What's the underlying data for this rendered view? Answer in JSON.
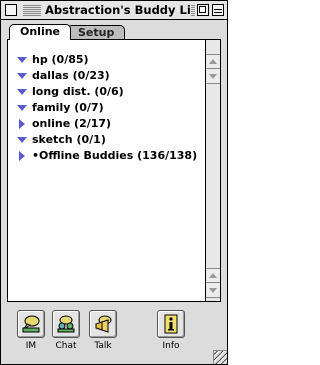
{
  "window": {
    "title": "Abstraction's Buddy List"
  },
  "tabs": [
    {
      "label": "Online",
      "active": true
    },
    {
      "label": "Setup",
      "active": false
    }
  ],
  "groups": [
    {
      "label": "hp (0/85)",
      "expanded": true
    },
    {
      "label": "dallas (0/23)",
      "expanded": true
    },
    {
      "label": "long dist. (0/6)",
      "expanded": true
    },
    {
      "label": "family (0/7)",
      "expanded": true
    },
    {
      "label": "online (2/17)",
      "expanded": false
    },
    {
      "label": "sketch (0/1)",
      "expanded": true
    },
    {
      "label": "•Offline Buddies (136/138)",
      "expanded": false
    }
  ],
  "toolbar": {
    "im_label": "IM",
    "chat_label": "Chat",
    "talk_label": "Talk",
    "info_label": "Info"
  },
  "colors": {
    "arrow": "#5a5ad0",
    "window_bg": "#dcdcdc",
    "panel_bg": "#ffffff"
  }
}
